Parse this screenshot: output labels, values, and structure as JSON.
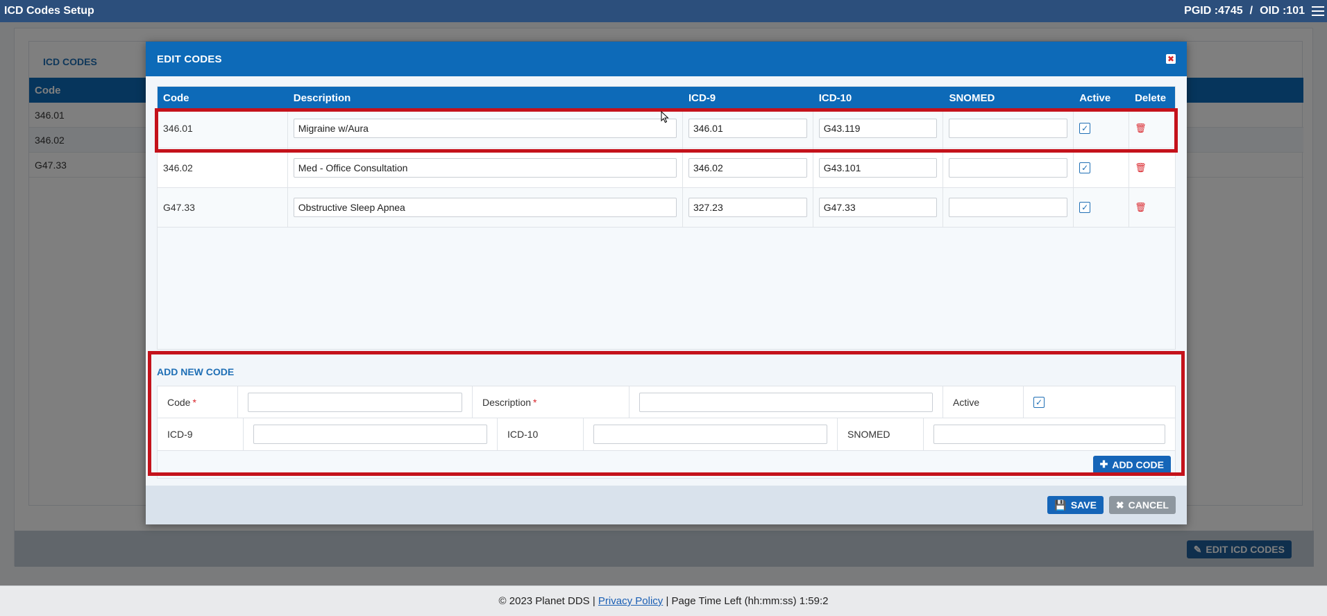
{
  "app": {
    "title": "ICD Codes Setup",
    "pgid": "PGID :4745",
    "separator": "/",
    "oid": "OID :101"
  },
  "background": {
    "section_title": "ICD CODES",
    "table_header": "Code",
    "rows": [
      "346.01",
      "346.02",
      "G47.33"
    ],
    "edit_button": "EDIT ICD CODES"
  },
  "modal": {
    "title": "EDIT CODES",
    "close_glyph": "✖",
    "columns": {
      "code": "Code",
      "description": "Description",
      "icd9": "ICD-9",
      "icd10": "ICD-10",
      "snomed": "SNOMED",
      "active": "Active",
      "delete": "Delete"
    },
    "rows": [
      {
        "code": "346.01",
        "description": "Migraine w/Aura",
        "icd9": "346.01",
        "icd10": "G43.119",
        "snomed": "",
        "active": true
      },
      {
        "code": "346.02",
        "description": "Med - Office Consultation",
        "icd9": "346.02",
        "icd10": "G43.101",
        "snomed": "",
        "active": true
      },
      {
        "code": "G47.33",
        "description": "Obstructive Sleep Apnea",
        "icd9": "327.23",
        "icd10": "G47.33",
        "snomed": "",
        "active": true
      }
    ],
    "add_new": {
      "title": "ADD NEW CODE",
      "code_label": "Code",
      "description_label": "Description",
      "active_label": "Active",
      "required_mark": "*",
      "icd9_label": "ICD-9",
      "icd10_label": "ICD-10",
      "snomed_label": "SNOMED",
      "code_value": "",
      "description_value": "",
      "icd9_value": "",
      "icd10_value": "",
      "snomed_value": "",
      "active": true,
      "add_button": "ADD CODE"
    },
    "save_button": "SAVE",
    "cancel_button": "CANCEL"
  },
  "footer": {
    "copyright": "© 2023 Planet DDS |",
    "privacy_link": "Privacy Policy",
    "time_left": "|  Page Time Left (hh:mm:ss) 1:59:2"
  },
  "colors": {
    "header_blue": "#0d6ab8",
    "topbar": "#2c4f7c",
    "highlight": "#c4121b",
    "delete_red": "#d9262c"
  }
}
